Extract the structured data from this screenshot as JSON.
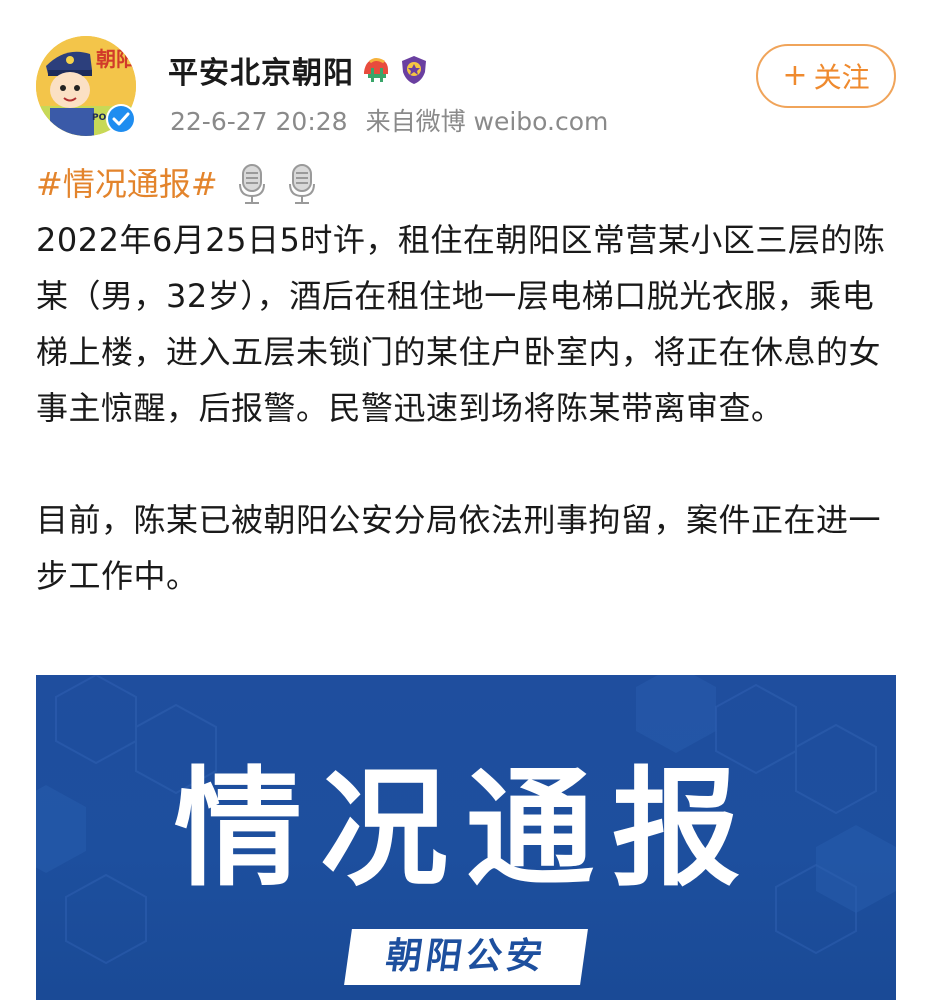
{
  "account": {
    "name": "平安北京朝阳",
    "avatar_text": "朝阳",
    "avatar_badge": "POLICE",
    "avatar_icon": "police-cartoon-avatar",
    "verified_icon": "verified-check-icon",
    "badges": [
      "helmet-badge-icon",
      "police-shield-badge-icon"
    ]
  },
  "meta": {
    "time": "22-6-27 20:28",
    "source": "来自微博 weibo.com"
  },
  "follow_button": {
    "plus": "+",
    "label": "关注"
  },
  "post": {
    "hashtag": "#情况通报#",
    "hashtag_icons": [
      "microphone-icon",
      "microphone-icon"
    ],
    "paragraphs": [
      "2022年6月25日5时许，租住在朝阳区常营某小区三层的陈某（男，32岁），酒后在租住地一层电梯口脱光衣服，乘电梯上楼，进入五层未锁门的某住户卧室内，将正在休息的女事主惊醒，后报警。民警迅速到场将陈某带离审查。",
      "目前，陈某已被朝阳公安分局依法刑事拘留，案件正在进一步工作中。"
    ]
  },
  "banner": {
    "title": "情况通报",
    "subtitle": "朝阳公安"
  },
  "colors": {
    "accent": "#e3842c",
    "follow_border": "#f0a45a",
    "meta_text": "#8a8a8a",
    "banner_bg": "#1d4f9e"
  }
}
